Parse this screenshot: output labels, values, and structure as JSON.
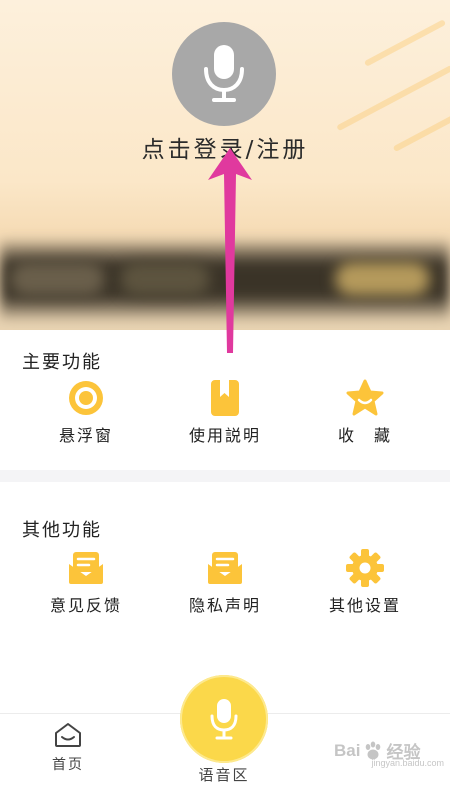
{
  "header": {
    "login_text": "点击登录/注册",
    "avatar_icon": "microphone-icon"
  },
  "main_functions": {
    "title": "主要功能",
    "items": [
      {
        "label": "悬浮窗",
        "icon": "floating-window-icon"
      },
      {
        "label": "使用説明",
        "icon": "bookmark-icon"
      },
      {
        "label": "收　藏",
        "icon": "star-icon"
      }
    ]
  },
  "other_functions": {
    "title": "其他功能",
    "items": [
      {
        "label": "意见反馈",
        "icon": "message-envelope-icon"
      },
      {
        "label": "隐私声明",
        "icon": "message-envelope-icon"
      },
      {
        "label": "其他设置",
        "icon": "gear-icon"
      }
    ]
  },
  "bottom_nav": {
    "home_label": "首页",
    "voice_label": "语音区"
  },
  "watermark": {
    "text_left": "Bai",
    "text_right": "经验",
    "sub": "jingyan.baidu.com"
  },
  "colors": {
    "accent_yellow": "#fbd84a",
    "icon_yellow": "#fcc43a",
    "arrow_pink": "#e0399e",
    "avatar_gray": "#a8a8a8"
  }
}
